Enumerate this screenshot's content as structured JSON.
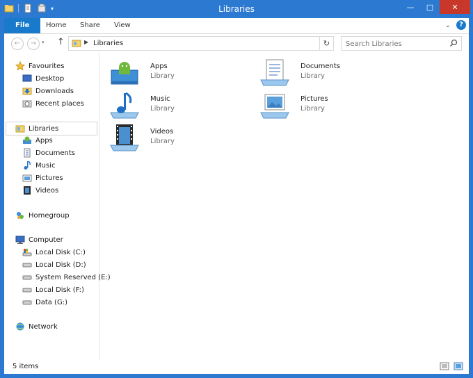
{
  "window": {
    "title": "Libraries"
  },
  "ribbon": {
    "tabs": [
      "File",
      "Home",
      "Share",
      "View"
    ]
  },
  "address": {
    "crumb": "Libraries",
    "search_placeholder": "Search Libraries"
  },
  "nav": {
    "favourites": "Favourites",
    "fav_items": [
      "Desktop",
      "Downloads",
      "Recent places"
    ],
    "libraries": "Libraries",
    "lib_items": [
      "Apps",
      "Documents",
      "Music",
      "Pictures",
      "Videos"
    ],
    "homegroup": "Homegroup",
    "computer": "Computer",
    "drives": [
      "Local Disk (C:)",
      "Local Disk (D:)",
      "System Reserved (E:)",
      "Local Disk (F:)",
      "Data (G:)"
    ],
    "network": "Network"
  },
  "libraries": [
    {
      "name": "Apps",
      "type": "Library",
      "icon": "apps-library-icon"
    },
    {
      "name": "Documents",
      "type": "Library",
      "icon": "documents-library-icon"
    },
    {
      "name": "Music",
      "type": "Library",
      "icon": "music-library-icon"
    },
    {
      "name": "Pictures",
      "type": "Library",
      "icon": "pictures-library-icon"
    },
    {
      "name": "Videos",
      "type": "Library",
      "icon": "videos-library-icon"
    }
  ],
  "status": {
    "count": "5 items"
  },
  "colors": {
    "titlebar": "#2b79d1",
    "file_tab": "#1979ca",
    "close": "#c7382b"
  }
}
